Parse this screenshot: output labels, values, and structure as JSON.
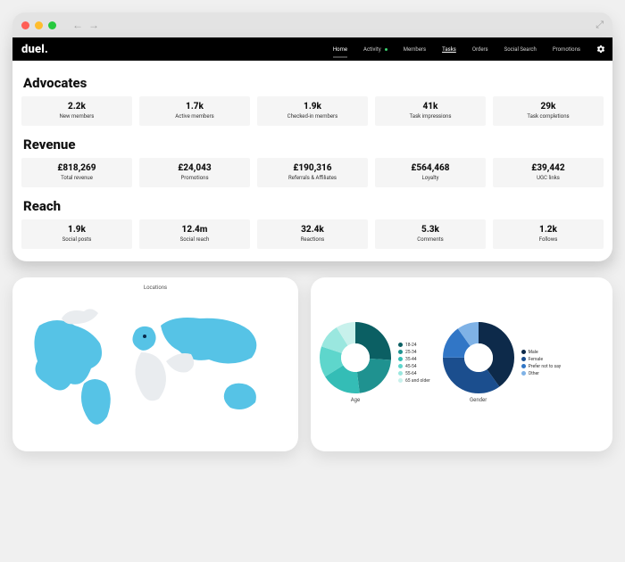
{
  "brand": "duel.",
  "nav": {
    "items": [
      {
        "label": "Home",
        "active": true
      },
      {
        "label": "Activity",
        "dot": true
      },
      {
        "label": "Members"
      },
      {
        "label": "Tasks",
        "underline": true
      },
      {
        "label": "Orders"
      },
      {
        "label": "Social Search"
      },
      {
        "label": "Promotions"
      }
    ],
    "settings_icon": "gear-icon"
  },
  "sections": {
    "advocates": {
      "title": "Advocates",
      "kpis": [
        {
          "value": "2.2k",
          "label": "New members"
        },
        {
          "value": "1.7k",
          "label": "Active members"
        },
        {
          "value": "1.9k",
          "label": "Checked-in members"
        },
        {
          "value": "41k",
          "label": "Task impressions"
        },
        {
          "value": "29k",
          "label": "Task completions"
        }
      ]
    },
    "revenue": {
      "title": "Revenue",
      "kpis": [
        {
          "value": "£818,269",
          "label": "Total revenue"
        },
        {
          "value": "£24,043",
          "label": "Promotions"
        },
        {
          "value": "£190,316",
          "label": "Referrals & Affiliates"
        },
        {
          "value": "£564,468",
          "label": "Loyalty"
        },
        {
          "value": "£39,442",
          "label": "UGC links"
        }
      ]
    },
    "reach": {
      "title": "Reach",
      "kpis": [
        {
          "value": "1.9k",
          "label": "Social posts"
        },
        {
          "value": "12.4m",
          "label": "Social reach"
        },
        {
          "value": "32.4k",
          "label": "Reactions"
        },
        {
          "value": "5.3k",
          "label": "Comments"
        },
        {
          "value": "1.2k",
          "label": "Follows"
        }
      ]
    }
  },
  "map": {
    "title": "Locations"
  },
  "chart_data": [
    {
      "type": "pie",
      "title": "Age",
      "series": [
        {
          "name": "18-24",
          "value": 26,
          "color": "#0b5f63"
        },
        {
          "name": "25-34",
          "value": 22,
          "color": "#1f9290"
        },
        {
          "name": "35-44",
          "value": 18,
          "color": "#34bdb6"
        },
        {
          "name": "45-54",
          "value": 14,
          "color": "#5ed6cc"
        },
        {
          "name": "55-64",
          "value": 11,
          "color": "#9ae7df"
        },
        {
          "name": "65 and older",
          "value": 9,
          "color": "#c8f1ec"
        }
      ],
      "donut": true
    },
    {
      "type": "pie",
      "title": "Gender",
      "series": [
        {
          "name": "Male",
          "value": 40,
          "color": "#0d2a4a"
        },
        {
          "name": "Female",
          "value": 35,
          "color": "#1b4e8e"
        },
        {
          "name": "Prefer not to say",
          "value": 15,
          "color": "#3176c6"
        },
        {
          "name": "Other",
          "value": 10,
          "color": "#7fb2e6"
        }
      ],
      "donut": true
    }
  ]
}
